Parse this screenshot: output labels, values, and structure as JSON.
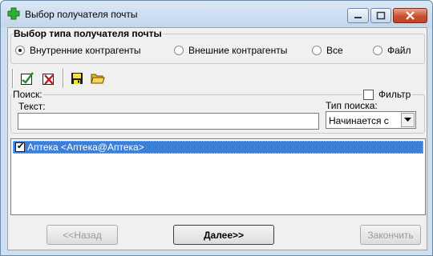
{
  "window": {
    "title": "Выбор получателя почты"
  },
  "recipient_type": {
    "legend": "Выбор типа получателя почты",
    "options": [
      {
        "label": "Внутренние контрагенты",
        "checked": true
      },
      {
        "label": "Внешние контрагенты",
        "checked": false
      },
      {
        "label": "Все",
        "checked": false
      },
      {
        "label": "Файл",
        "checked": false
      }
    ]
  },
  "toolbar": {
    "icons": [
      "check-all-icon",
      "uncheck-all-icon",
      "save-icon",
      "open-folder-icon"
    ]
  },
  "search": {
    "legend": "Поиск:",
    "filter_label": "Фильтр",
    "filter_checked": false,
    "text_label": "Текст:",
    "text_value": "",
    "type_label": "Тип поиска:",
    "type_value": "Начинается с"
  },
  "recipients": [
    {
      "text": "Аптека <Аптека@Аптека>",
      "checked": true,
      "selected": true
    }
  ],
  "buttons": {
    "back": "<<Назад",
    "next": "Далее>>",
    "finish": "Закончить"
  }
}
